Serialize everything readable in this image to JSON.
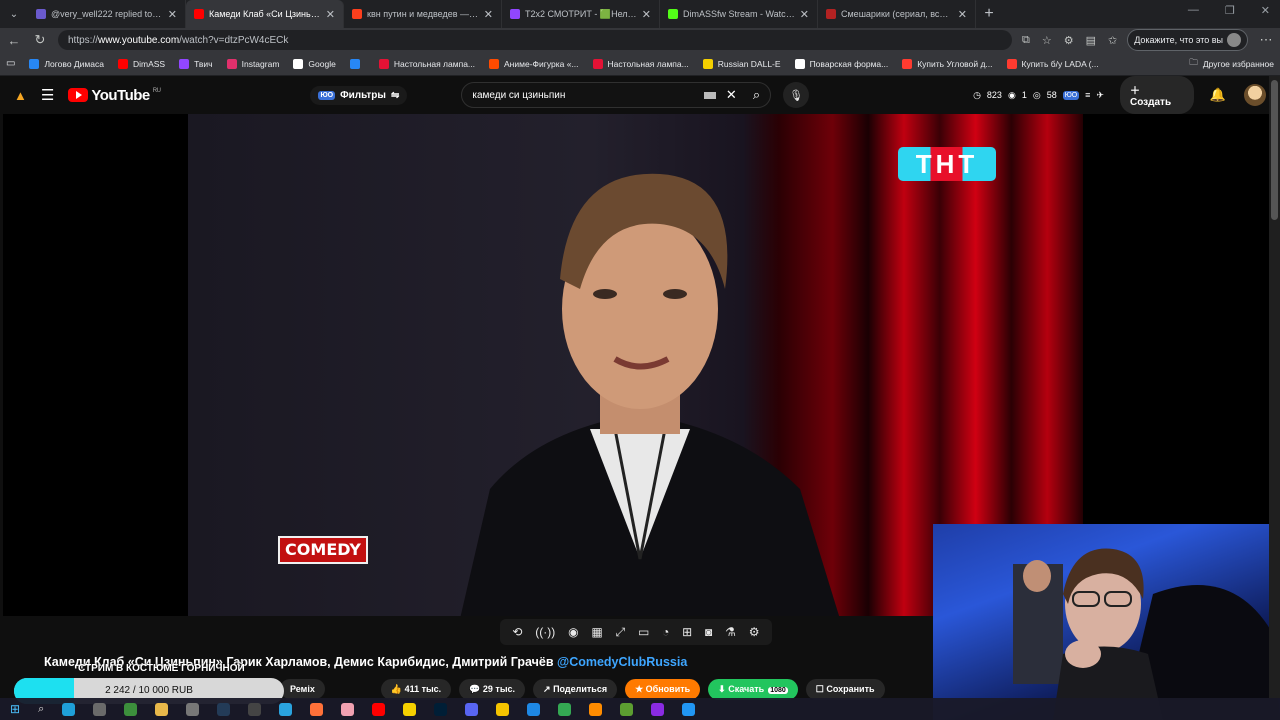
{
  "browser": {
    "tabs": [
      {
        "title": "@very_well222 replied to you",
        "color": "#6a5acd",
        "active": false
      },
      {
        "title": "Камеди Клаб «Си Цзиньпин",
        "color": "#ff0000",
        "active": true
      },
      {
        "title": "квн путин и медведев — Яндекс",
        "color": "#fc3f1d",
        "active": false
      },
      {
        "title": "T2x2 СМОТРИТ - 🟩Нелегалом в",
        "color": "#9146ff",
        "active": false
      },
      {
        "title": "DimASSfw Stream - Watch Live on",
        "color": "#53fc18",
        "active": false
      },
      {
        "title": "Смешарики (сериал, все серии, 2",
        "color": "#b22222",
        "active": false
      }
    ],
    "url_prefix": "https://",
    "url_domain": "www.youtube.com",
    "url_rest": "/watch?v=dtzPcW4cECk",
    "captcha_label": "Докажите, что это вы"
  },
  "bookmarks": [
    {
      "label": "Логово Димаса",
      "color": "#2787f5"
    },
    {
      "label": "DimASS",
      "color": "#ff0000"
    },
    {
      "label": "Твич",
      "color": "#9146ff"
    },
    {
      "label": "Instagram",
      "color": "#e1306c"
    },
    {
      "label": "Google",
      "color": "#ffffff"
    },
    {
      "label": "",
      "color": "#2787f5"
    },
    {
      "label": "Настольная лампа...",
      "color": "#e31235"
    },
    {
      "label": "Аниме-Фигурка «...",
      "color": "#ff4b00"
    },
    {
      "label": "Настольная лампа...",
      "color": "#e31235"
    },
    {
      "label": "Russian DALL-E",
      "color": "#f5d000"
    },
    {
      "label": "Поварская форма...",
      "color": "#ffffff"
    },
    {
      "label": "Купить Угловой д...",
      "color": "#ff3b30"
    },
    {
      "label": "Купить б/у LADA (...",
      "color": "#ff3b30"
    }
  ],
  "bookmarks_other": "Другое избранное",
  "youtube": {
    "logo_text": "YouTube",
    "logo_region": "RU",
    "filters_label": "Фильтры",
    "filters_badge": "ЮО",
    "search_query": "камеди си цзиньпин",
    "stats": [
      "823",
      "1",
      "58"
    ],
    "stats_badge": "ЮО",
    "create_label": "Создать"
  },
  "video": {
    "channel_logo": "ТНТ",
    "show_logo": "COMEDY",
    "title": "Камеди Клаб «Си Цзиньпин» Гарик Харламов, Демис Карибидис, Дмитрий Грачёв",
    "channel_link": "@ComedyClubRussia",
    "likes": "411 тыс.",
    "comments": "29 тыс.",
    "share_label": "Поделиться",
    "update_label": "Обновить",
    "download_label": "Скачать",
    "download_res": "1080",
    "save_label": "Сохранить",
    "small_pill": "Ремix"
  },
  "donation": {
    "label": "СТРИМ В КОСТЮМЕ ГОРНИЧНОЙ",
    "amount_text": "2 242 / 10 000 RUB",
    "progress": 0.224
  }
}
